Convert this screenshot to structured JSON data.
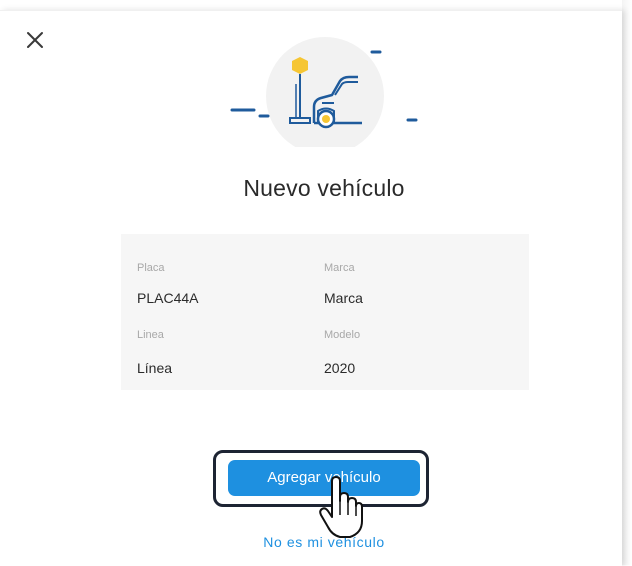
{
  "modal": {
    "title": "Nuevo vehículo",
    "close_icon": "close-icon"
  },
  "vehicle": {
    "placa_label": "Placa",
    "placa_value": "PLAC44A",
    "marca_label": "Marca",
    "marca_value": "Marca",
    "linea_label": "Linea",
    "linea_value": "Línea",
    "modelo_label": "Modelo",
    "modelo_value": "2020"
  },
  "actions": {
    "add_label": "Agregar vehículo",
    "not_mine_label": "No es mi vehículo"
  },
  "colors": {
    "accent": "#1e90e0",
    "illustration_navy": "#1f5b9c",
    "illustration_yellow": "#f6c633",
    "card_bg": "#f6f6f6",
    "focus_ring": "#1d2433"
  }
}
